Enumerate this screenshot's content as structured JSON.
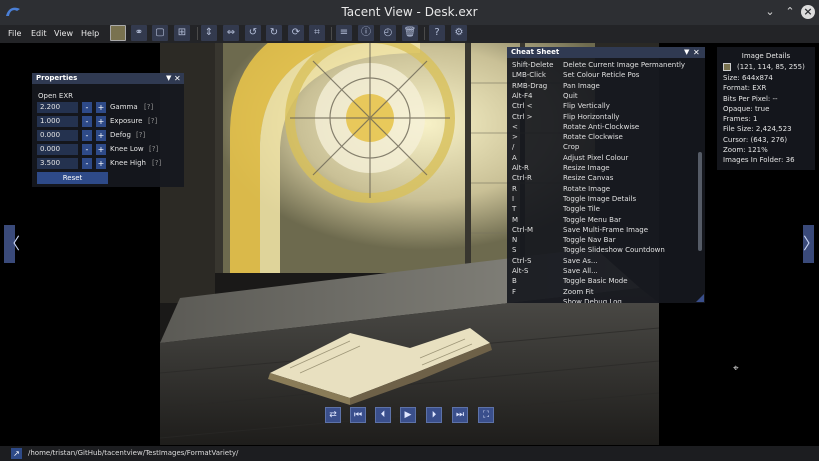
{
  "window": {
    "title": "Tacent View - Desk.exr"
  },
  "menubar": {
    "items": [
      "File",
      "Edit",
      "View",
      "Help"
    ]
  },
  "toolbar": {
    "icons": [
      "colour-swatch-icon",
      "channels-icon",
      "frame-icon",
      "tile-icon",
      "flip-vertical-icon",
      "flip-horizontal-icon",
      "rotate-anticlockwise-icon",
      "rotate-clockwise-icon",
      "rotate-image-icon",
      "crop-icon",
      "properties-icon",
      "info-icon",
      "slideshow-icon",
      "delete-icon",
      "help-icon",
      "settings-icon"
    ]
  },
  "properties": {
    "title": "Properties",
    "section": "Open EXR",
    "rows": [
      {
        "value": "2.200",
        "label": "Gamma",
        "hint": "[?]"
      },
      {
        "value": "1.000",
        "label": "Exposure",
        "hint": "[?]"
      },
      {
        "value": "0.000",
        "label": "Defog",
        "hint": "[?]"
      },
      {
        "value": "0.000",
        "label": "Knee Low",
        "hint": "[?]"
      },
      {
        "value": "3.500",
        "label": "Knee High",
        "hint": "[?]"
      }
    ],
    "minus": "-",
    "plus": "+",
    "reset": "Reset"
  },
  "cheat_sheet": {
    "title": "Cheat Sheet",
    "entries": [
      {
        "key": "Shift-Delete",
        "action": "Delete Current Image Permanently"
      },
      {
        "key": "LMB-Click",
        "action": "Set Colour Reticle Pos"
      },
      {
        "key": "RMB-Drag",
        "action": "Pan Image"
      },
      {
        "key": "Alt-F4",
        "action": "Quit"
      },
      {
        "key": "Ctrl <",
        "action": "Flip Vertically"
      },
      {
        "key": "Ctrl >",
        "action": "Flip Horizontally"
      },
      {
        "key": "<",
        "action": "Rotate Anti-Clockwise"
      },
      {
        "key": ">",
        "action": "Rotate Clockwise"
      },
      {
        "key": "/",
        "action": "Crop"
      },
      {
        "key": "A",
        "action": "Adjust Pixel Colour"
      },
      {
        "key": "Alt-R",
        "action": "Resize Image"
      },
      {
        "key": "Ctrl-R",
        "action": "Resize Canvas"
      },
      {
        "key": "R",
        "action": "Rotate Image"
      },
      {
        "key": "I",
        "action": "Toggle Image Details"
      },
      {
        "key": "T",
        "action": "Toggle Tile"
      },
      {
        "key": "M",
        "action": "Toggle Menu Bar"
      },
      {
        "key": "Ctrl-M",
        "action": "Save Multi-Frame Image"
      },
      {
        "key": "N",
        "action": "Toggle Nav Bar"
      },
      {
        "key": "S",
        "action": "Toggle Slideshow Countdown"
      },
      {
        "key": "Ctrl-S",
        "action": "Save As..."
      },
      {
        "key": "Alt-S",
        "action": "Save All..."
      },
      {
        "key": "B",
        "action": "Toggle Basic Mode"
      },
      {
        "key": "F",
        "action": "Zoom Fit"
      },
      {
        "key": "",
        "action": "Show Debug Log"
      }
    ]
  },
  "image_details": {
    "title": "Image  Details",
    "swatch_color": "#79724f",
    "rgba": "(121, 114, 85, 255)",
    "lines": [
      "Size: 644x874",
      "Format: EXR",
      "Bits Per Pixel: --",
      "Opaque: true",
      "Frames: 1",
      "File Size: 2,424,523",
      "Cursor: (643, 276)",
      "Zoom: 121%",
      "Images In Folder: 36"
    ]
  },
  "nav": {
    "prev": "〈",
    "next": "〉"
  },
  "playback": {
    "icons": [
      "repeat-icon",
      "skip-first-icon",
      "step-back-icon",
      "play-icon",
      "step-forward-icon",
      "skip-last-icon",
      "fullscreen-icon"
    ]
  },
  "statusbar": {
    "path": "/home/tristan/GitHub/tacentview/TestImages/FormatVariety/"
  },
  "colors": {
    "accent": "#3a4f8c",
    "panel_header": "#303a52"
  }
}
